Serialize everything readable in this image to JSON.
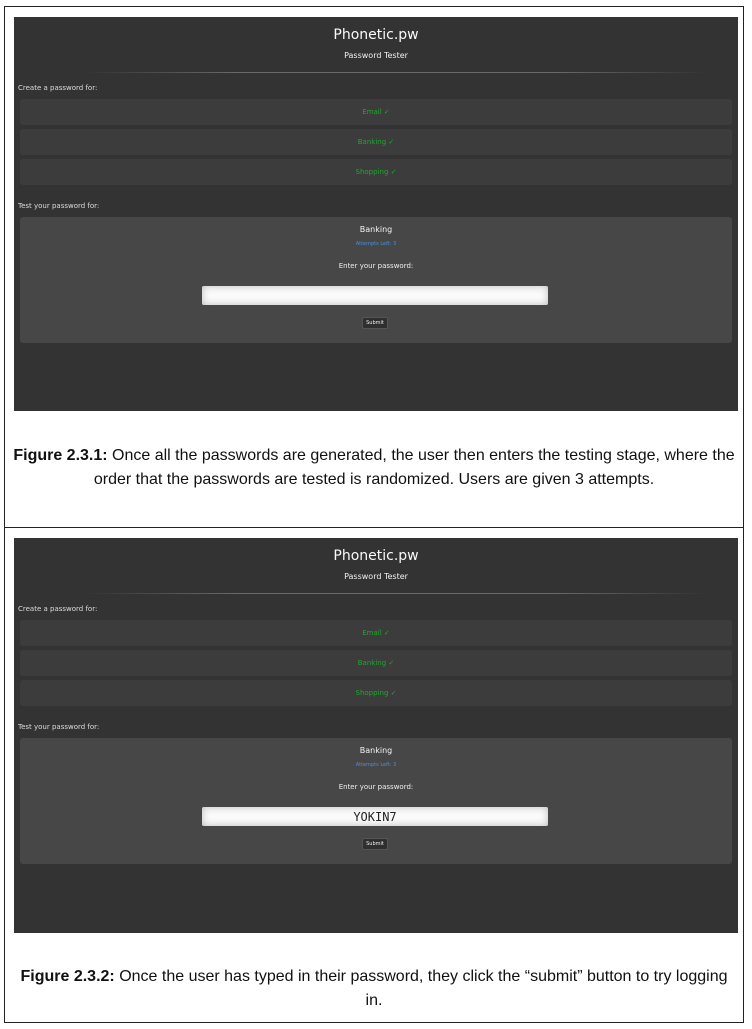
{
  "figures": [
    {
      "app": {
        "title": "Phonetic.pw",
        "subtitle": "Password Tester",
        "create_label": "Create a password for:",
        "sites": [
          {
            "label": "Email ✓"
          },
          {
            "label": "Banking ✓"
          },
          {
            "label": "Shopping ✓"
          }
        ],
        "test_label": "Test your password for:",
        "test_panel": {
          "site": "Banking",
          "attempts": "Attempts Left: 3",
          "prompt": "Enter your password:",
          "password_value": "",
          "submit_label": "Submit"
        }
      },
      "caption_label": "Figure 2.3.1:",
      "caption_text": " Once all the passwords are generated, the user then enters the testing stage, where the order that the passwords are tested is randomized. Users are given 3 attempts."
    },
    {
      "app": {
        "title": "Phonetic.pw",
        "subtitle": "Password Tester",
        "create_label": "Create a password for:",
        "sites": [
          {
            "label": "Email ✓"
          },
          {
            "label": "Banking ✓"
          },
          {
            "label": "Shopping ✓"
          }
        ],
        "test_label": "Test your password for:",
        "test_panel": {
          "site": "Banking",
          "attempts": "Attempts Left: 3",
          "prompt": "Enter your password:",
          "password_value": "YOKIN7",
          "submit_label": "Submit"
        }
      },
      "caption_label": "Figure 2.3.2:",
      "caption_text": " Once the user has typed in their password, they click the “submit” button to try logging in."
    }
  ],
  "colors": {
    "app_background": "#333333",
    "site_bar": "#3c3c3c",
    "check_green": "#22a52e",
    "panel": "#474747",
    "attempts_blue": "#4a90d9"
  }
}
